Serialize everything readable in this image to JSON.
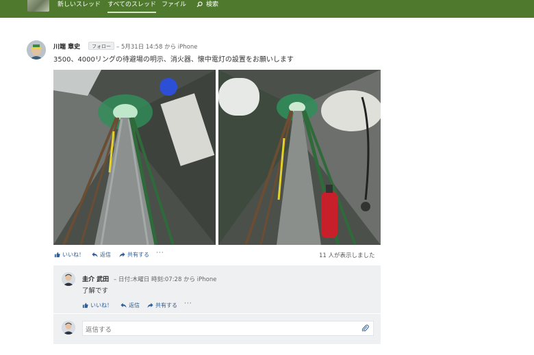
{
  "nav": {
    "items": [
      {
        "label": "新しいスレッド",
        "active": false
      },
      {
        "label": "すべてのスレッド",
        "active": true
      },
      {
        "label": "ファイル",
        "active": false
      },
      {
        "label": "検索",
        "active": false
      }
    ],
    "search_icon": "search-icon",
    "bar_color": "#4f7a2e"
  },
  "post": {
    "author": "川端 章史",
    "follow_label": "フォロー",
    "meta": "– 5月31日 14:58 から iPhone",
    "text": "3500、4000リングの待避場の明示、消火器、懐中電灯の設置をお願いします",
    "photos": [
      "tunnel-photo-1",
      "tunnel-photo-2"
    ],
    "actions": {
      "like_label": "いいね！",
      "reply_label": "返信",
      "share_label": "共有する",
      "more_label": "···"
    },
    "view_count": "11 人が表示しました"
  },
  "reply": {
    "author": "圭介 武田",
    "meta": "– 日付:木曜日 時刻:07:28 から iPhone",
    "text": "了解です",
    "actions": {
      "like_label": "いいね！",
      "reply_label": "返信",
      "share_label": "共有する",
      "more_label": "···"
    }
  },
  "composer": {
    "placeholder": "返信する",
    "attach_icon": "paperclip-icon"
  },
  "colors": {
    "link": "#2f5f9a",
    "panel": "#eef0f2"
  }
}
